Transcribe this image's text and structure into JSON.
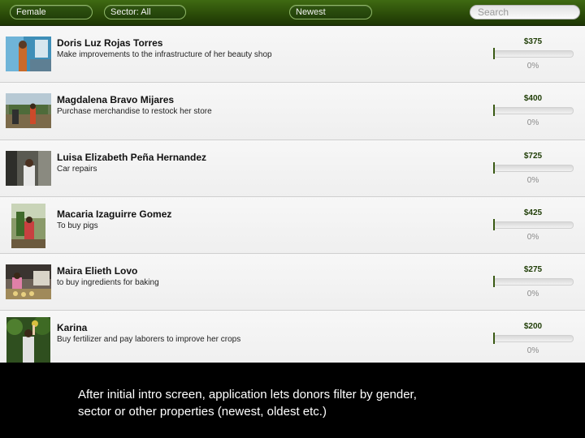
{
  "toolbar": {
    "gender_filter": "Female",
    "sector_filter": "Sector: All",
    "sort_filter": "Newest",
    "search_placeholder": "Search"
  },
  "loans": [
    {
      "name": "Doris Luz Rojas Torres",
      "description": "Make improvements to the infrastructure of her beauty shop",
      "amount": "$375",
      "funded_percent": 0,
      "funded_label": "0%"
    },
    {
      "name": "Magdalena Bravo Mijares",
      "description": "Purchase merchandise to restock her store",
      "amount": "$400",
      "funded_percent": 0,
      "funded_label": "0%"
    },
    {
      "name": "Luisa Elizabeth Peña Hernandez",
      "description": "Car repairs",
      "amount": "$725",
      "funded_percent": 0,
      "funded_label": "0%"
    },
    {
      "name": "Macaria Izaguirre Gomez",
      "description": "To buy pigs",
      "amount": "$425",
      "funded_percent": 0,
      "funded_label": "0%"
    },
    {
      "name": "Maira Elieth Lovo",
      "description": "to buy ingredients for baking",
      "amount": "$275",
      "funded_percent": 0,
      "funded_label": "0%"
    },
    {
      "name": "Karina",
      "description": "Buy fertilizer and pay laborers to improve her crops",
      "amount": "$200",
      "funded_percent": 0,
      "funded_label": "0%"
    }
  ],
  "caption": {
    "line1": "After initial intro screen, application lets donors filter by gender,",
    "line2": "sector or other properties (newest, oldest etc.)"
  },
  "colors": {
    "toolbar_green": "#2a4a08",
    "amount_green": "#1f3d06",
    "progress_fill": "#4f7c19"
  }
}
